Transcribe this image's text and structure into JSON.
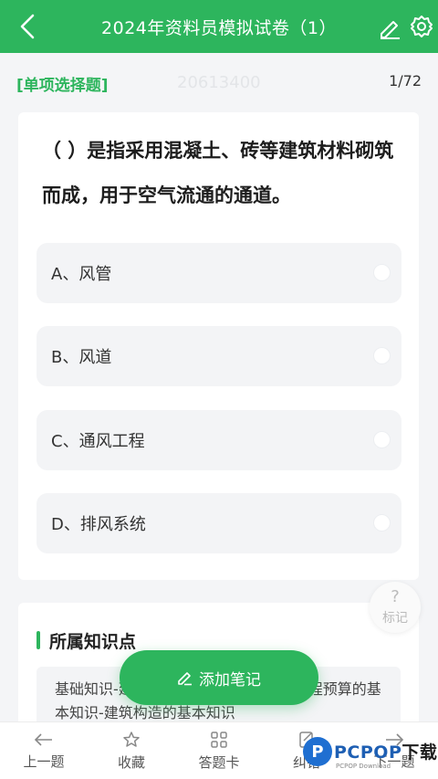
{
  "header": {
    "title": "2024年资料员模拟试卷（1）",
    "icons": [
      "back-icon",
      "edit-icon",
      "gear-icon"
    ]
  },
  "question": {
    "type_label": "[单项选择题]",
    "watermark": "20613400",
    "progress": "1/72",
    "text": "（ ）是指采用混凝土、砖等建筑材料砌筑而成，用于空气流通的通道。",
    "options": [
      {
        "label": "A、风管"
      },
      {
        "label": "B、风道"
      },
      {
        "label": "C、通风工程"
      },
      {
        "label": "D、排风系统"
      }
    ]
  },
  "mark": {
    "label": "标记",
    "symbol": "?"
  },
  "knowledge": {
    "title": "所属知识点",
    "text": "基础知识-建筑工程识图与施工工艺和工程预算的基本知识-建筑构造的基本知识"
  },
  "add_note": {
    "label": "添加笔记"
  },
  "bottom_nav": {
    "items": [
      {
        "label": "上一题"
      },
      {
        "label": "收藏"
      },
      {
        "label": "答题卡"
      },
      {
        "label": "纠错"
      },
      {
        "label": "下一题"
      }
    ]
  },
  "logo": {
    "mark": "P",
    "brand_en": "PCPOP",
    "brand_cn": "下载",
    "sub": "PCPOP Download"
  },
  "colors": {
    "accent": "#2db55d",
    "logo_blue": "#1f6fd1"
  }
}
